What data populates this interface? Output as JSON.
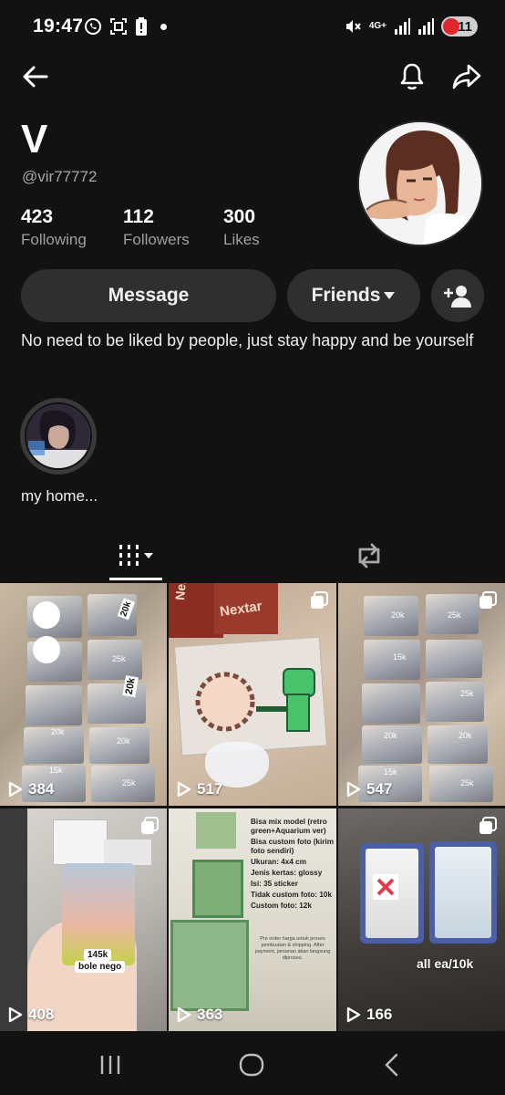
{
  "status_bar": {
    "time": "19:47",
    "network": "4G+",
    "battery": "11",
    "icons": [
      "whatsapp-icon",
      "screenshot-icon",
      "battery-alert-icon",
      "mute-icon",
      "signal-icon"
    ]
  },
  "profile": {
    "display_name": "V",
    "username": "@vir77772",
    "stats": [
      {
        "value": "423",
        "label": "Following"
      },
      {
        "value": "112",
        "label": "Followers"
      },
      {
        "value": "300",
        "label": "Likes"
      }
    ],
    "bio": "No need to be liked by people, just stay happy and be yourself"
  },
  "actions": {
    "message_label": "Message",
    "friends_label": "Friends"
  },
  "highlight": {
    "label": "my home..."
  },
  "videos": [
    {
      "views": "384",
      "tags": [
        "20k",
        "25k",
        "20k",
        "20k",
        "20k",
        "15k",
        "25k"
      ]
    },
    {
      "views": "517",
      "tags": [
        "Nextar",
        "Nextar"
      ]
    },
    {
      "views": "547",
      "tags": [
        "20k",
        "25k",
        "15k",
        "25k",
        "20k",
        "20k",
        "15k",
        "25k"
      ]
    },
    {
      "views": "408",
      "tags": [
        "145k",
        "bole nego"
      ]
    },
    {
      "views": "363",
      "lines": [
        "Bisa mix model (retro green+Aquarium ver)",
        "Bisa custom foto (kirim foto sendiri)",
        "Ukuran: 4x4 cm",
        "Jenis kertas: glossy",
        "Isi: 35 sticker",
        "Tidak custom foto: 10k",
        "Custom foto: 12k"
      ],
      "note": "Pre order harga untuk proses pembuatan & shipping. After payment, pesanan akan langsung diproses."
    },
    {
      "views": "166",
      "caption": "all ea/10k"
    }
  ],
  "colors": {
    "background": "#121212",
    "button": "#2f2f2f",
    "muted_text": "#a0a0a0",
    "battery_low": "#e0262e"
  }
}
